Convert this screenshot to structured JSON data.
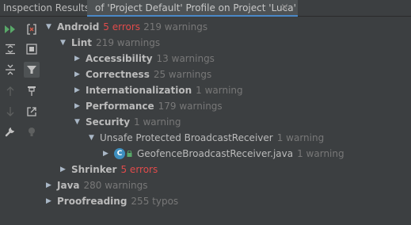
{
  "header": {
    "title": "Inspection Results:",
    "tab_label": "of 'Project Default' Profile on Project 'Luca'",
    "tab_close": "×"
  },
  "toolbar": {
    "buttons": [
      {
        "name": "rerun-icon",
        "pressed": false
      },
      {
        "name": "close-panel-icon",
        "pressed": false
      },
      {
        "name": "expand-all-icon",
        "pressed": false
      },
      {
        "name": "group-by-icon",
        "pressed": false
      },
      {
        "name": "collapse-all-icon",
        "pressed": false
      },
      {
        "name": "filter-icon",
        "pressed": true
      },
      {
        "name": "previous-problem-icon",
        "pressed": false
      },
      {
        "name": "pin-icon",
        "pressed": false
      },
      {
        "name": "next-problem-icon",
        "pressed": false
      },
      {
        "name": "export-icon",
        "pressed": false
      },
      {
        "name": "settings-wrench-icon",
        "pressed": false
      },
      {
        "name": "quick-fix-bulb-icon",
        "pressed": false
      }
    ]
  },
  "tree": {
    "android": {
      "label": "Android",
      "errors": "5 errors",
      "count": "219 warnings"
    },
    "lint": {
      "label": "Lint",
      "count": "219 warnings"
    },
    "accessibility": {
      "label": "Accessibility",
      "count": "13 warnings"
    },
    "correctness": {
      "label": "Correctness",
      "count": "25 warnings"
    },
    "internationalization": {
      "label": "Internationalization",
      "count": "1 warning"
    },
    "performance": {
      "label": "Performance",
      "count": "179 warnings"
    },
    "security": {
      "label": "Security",
      "count": "1 warning"
    },
    "unsafe_receiver": {
      "label": "Unsafe Protected BroadcastReceiver",
      "count": "1 warning"
    },
    "geofence": {
      "label": "GeofenceBroadcastReceiver.java",
      "count": "1 warning",
      "icon_letter": "C"
    },
    "shrinker": {
      "label": "Shrinker",
      "errors": "5 errors"
    },
    "java": {
      "label": "Java",
      "count": "280 warnings"
    },
    "proofreading": {
      "label": "Proofreading",
      "count": "255 typos"
    }
  },
  "colors": {
    "background": "#3c3f41",
    "text": "#bbbbbb",
    "muted": "#787878",
    "error": "#e04b4b",
    "accent": "#4a88c7",
    "run_green": "#59a869"
  }
}
